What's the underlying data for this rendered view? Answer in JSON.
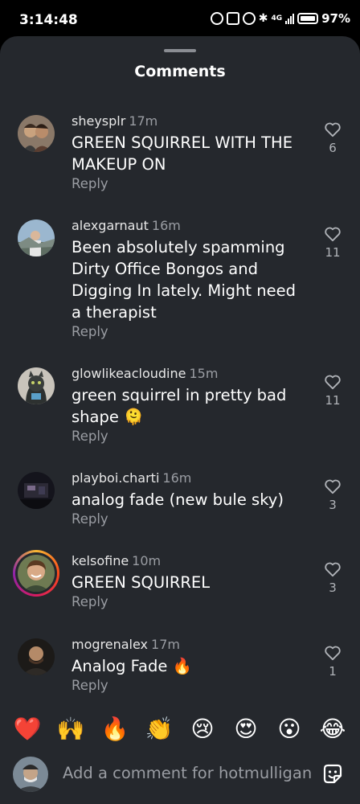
{
  "status_bar": {
    "time": "3:14:48",
    "network": "4G",
    "battery": "97%"
  },
  "sheet": {
    "title": "Comments"
  },
  "comments": [
    {
      "username": "sheysplr",
      "time": "17m",
      "text": "GREEN SQUIRREL WITH THE MAKEUP ON",
      "reply": "Reply",
      "likes": "6"
    },
    {
      "username": "alexgarnaut",
      "time": "16m",
      "text": "Been absolutely spamming Dirty Office Bongos and Digging In lately. Might need a therapist",
      "reply": "Reply",
      "likes": "11"
    },
    {
      "username": "glowlikeacloudine",
      "time": "15m",
      "text": "green squirrel in pretty bad shape 🫠",
      "reply": "Reply",
      "likes": "11"
    },
    {
      "username": "playboi.charti",
      "time": "16m",
      "text": "analog fade (new bule sky)",
      "reply": "Reply",
      "likes": "3"
    },
    {
      "username": "kelsofine",
      "time": "10m",
      "text": "GREEN SQUIRREL",
      "reply": "Reply",
      "likes": "3"
    },
    {
      "username": "mogrenalex",
      "time": "17m",
      "text": "Analog Fade 🔥",
      "reply": "Reply",
      "likes": "1"
    }
  ],
  "emoji_bar": [
    "❤️",
    "🙌",
    "🔥",
    "👏",
    "😢",
    "😍",
    "😮",
    "😂"
  ],
  "composer": {
    "placeholder": "Add a comment for hotmulligan"
  },
  "colors": {
    "sheet_bg": "#25282d",
    "muted_text": "#9a9da3",
    "story_ring": "#d81b60"
  },
  "icons": {
    "like": "heart-outline-icon",
    "sticker": "sticker-icon"
  }
}
